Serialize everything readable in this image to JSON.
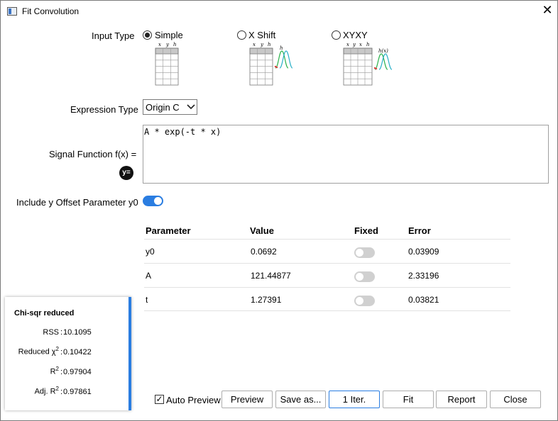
{
  "window": {
    "title": "Fit Convolution"
  },
  "input_type": {
    "label": "Input Type",
    "options": [
      {
        "label": "Simple",
        "selected": true,
        "columns": [
          "x",
          "y",
          "h"
        ]
      },
      {
        "label": "X Shift",
        "selected": false,
        "columns": [
          "x",
          "y",
          "h"
        ],
        "curve_label": "h"
      },
      {
        "label": "XYXY",
        "selected": false,
        "columns": [
          "x",
          "y",
          "x",
          "h"
        ],
        "curve_label": "h(x)"
      }
    ]
  },
  "expression_type": {
    "label": "Expression Type",
    "value": "Origin C"
  },
  "signal_function": {
    "label": "Signal Function f(x) =",
    "value": "A * exp(-t * x)",
    "badge": "y="
  },
  "y_offset": {
    "label": "Include y Offset Parameter y0",
    "on": true
  },
  "table": {
    "headers": [
      "Parameter",
      "Value",
      "Fixed",
      "Error"
    ],
    "rows": [
      {
        "parameter": "y0",
        "value": "0.0692",
        "fixed": false,
        "error": "0.03909"
      },
      {
        "parameter": "A",
        "value": "121.44877",
        "fixed": false,
        "error": "2.33196"
      },
      {
        "parameter": "t",
        "value": "1.27391",
        "fixed": false,
        "error": "0.03821"
      }
    ]
  },
  "stats": {
    "title": "Chi-sqr reduced",
    "rss_label": "RSS",
    "rss": "10.1095",
    "reduced_chi_label": "Reduced χ",
    "reduced_chi_sup": "2",
    "reduced_chi": "0.10422",
    "r2_label": "R",
    "r2_sup": "2",
    "r2": "0.97904",
    "adj_r2_label": "Adj. R",
    "adj_r2_sup": "2",
    "adj_r2": "0.97861",
    "colon": ":"
  },
  "footer": {
    "auto_preview_label": "Auto Preview",
    "auto_preview_checked": true,
    "buttons": {
      "preview": "Preview",
      "save_as": "Save as...",
      "iter": "1 Iter.",
      "fit": "Fit",
      "report": "Report",
      "close": "Close"
    }
  },
  "colors": {
    "accent": "#2a7de1",
    "curve_green": "#2bb24c",
    "curve_blue": "#2bb0c8",
    "curve_red": "#e04040"
  }
}
